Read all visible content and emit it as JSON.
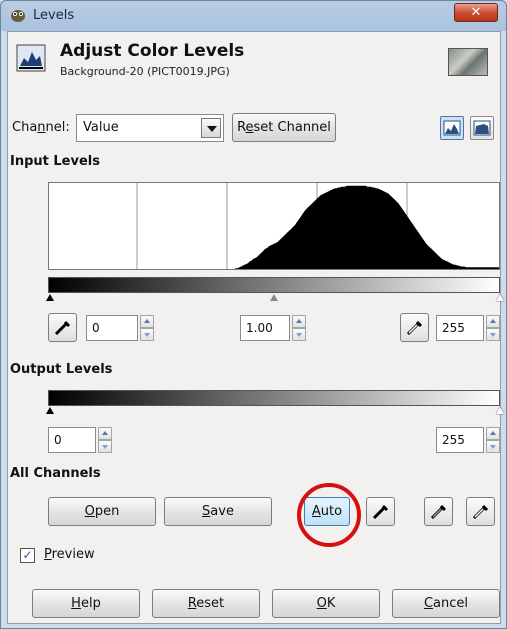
{
  "window": {
    "title": "Levels",
    "close_glyph": "✕"
  },
  "header": {
    "title": "Adjust Color Levels",
    "subtitle": "Background-20 (PICT0019.JPG)"
  },
  "channel": {
    "label_pre": "Cha",
    "label_u": "n",
    "label_post": "nel:",
    "value": "Value",
    "reset_pre": "R",
    "reset_u": "e",
    "reset_post": "set Channel"
  },
  "input_levels": {
    "heading": "Input Levels",
    "low": "0",
    "gamma": "1.00",
    "high": "255"
  },
  "output_levels": {
    "heading": "Output Levels",
    "low": "0",
    "high": "255"
  },
  "all_channels": {
    "heading": "All Channels",
    "open_u": "O",
    "open_rest": "pen",
    "save_u": "S",
    "save_rest": "ave",
    "auto_u": "A",
    "auto_rest": "uto"
  },
  "preview": {
    "u": "P",
    "rest": "review",
    "checked": true
  },
  "footer": {
    "help_u": "H",
    "help_rest": "elp",
    "reset_u": "R",
    "reset_rest": "eset",
    "ok_u": "O",
    "ok_rest": "K",
    "cancel_u": "C",
    "cancel_rest": "ancel"
  },
  "colors": {
    "highlight_circle": "#d61010",
    "accent": "#3c7fb1"
  },
  "histogram": {
    "type": "area",
    "bins": 256,
    "shape": [
      0,
      0,
      0,
      0,
      0,
      0,
      0,
      0,
      0,
      0,
      0,
      0,
      0,
      0,
      0,
      0,
      0,
      0,
      0,
      0,
      0,
      0,
      0,
      0,
      0,
      0,
      0,
      0,
      0,
      0,
      0,
      0,
      0,
      0,
      0,
      0,
      0,
      0,
      0,
      0,
      0,
      0,
      0,
      0,
      0,
      0,
      0,
      0,
      0,
      0,
      0,
      0,
      0,
      0,
      0,
      0,
      0,
      0,
      0,
      0,
      0,
      0,
      0,
      0,
      0,
      0,
      0,
      0,
      0,
      0,
      0,
      0,
      0,
      0,
      0,
      0,
      0,
      0,
      0,
      0,
      0,
      0,
      0,
      0,
      0,
      0,
      0,
      0,
      0,
      0,
      0,
      0,
      0,
      0,
      0,
      0,
      0,
      0,
      0,
      0,
      0,
      0,
      0,
      0,
      0,
      0,
      0,
      0,
      0.01,
      0.01,
      0.02,
      0.03,
      0.04,
      0.05,
      0.06,
      0.07,
      0.09,
      0.1,
      0.12,
      0.13,
      0.14,
      0.16,
      0.18,
      0.2,
      0.22,
      0.24,
      0.25,
      0.27,
      0.28,
      0.29,
      0.3,
      0.31,
      0.32,
      0.34,
      0.36,
      0.38,
      0.4,
      0.42,
      0.44,
      0.46,
      0.48,
      0.5,
      0.52,
      0.55,
      0.58,
      0.61,
      0.64,
      0.67,
      0.7,
      0.72,
      0.74,
      0.76,
      0.78,
      0.8,
      0.82,
      0.84,
      0.86,
      0.88,
      0.89,
      0.9,
      0.91,
      0.92,
      0.93,
      0.94,
      0.95,
      0.96,
      0.96,
      0.97,
      0.97,
      0.98,
      0.98,
      0.98,
      0.99,
      0.99,
      0.99,
      0.99,
      0.99,
      0.99,
      0.99,
      0.99,
      0.99,
      0.99,
      0.99,
      0.99,
      0.98,
      0.98,
      0.98,
      0.97,
      0.97,
      0.96,
      0.96,
      0.95,
      0.94,
      0.93,
      0.92,
      0.91,
      0.9,
      0.88,
      0.86,
      0.84,
      0.82,
      0.8,
      0.78,
      0.75,
      0.72,
      0.69,
      0.66,
      0.63,
      0.6,
      0.57,
      0.54,
      0.51,
      0.48,
      0.45,
      0.42,
      0.39,
      0.36,
      0.33,
      0.3,
      0.28,
      0.26,
      0.24,
      0.22,
      0.2,
      0.18,
      0.16,
      0.14,
      0.12,
      0.11,
      0.1,
      0.09,
      0.08,
      0.07,
      0.06,
      0.05,
      0.05,
      0.04,
      0.04,
      0.03,
      0.03,
      0.03,
      0.02,
      0.02,
      0.02,
      0.02,
      0.02,
      0.02,
      0.02,
      0.02,
      0.02,
      0.02,
      0.02,
      0.02,
      0.02,
      0.02,
      0.02,
      0.02,
      0.02,
      0.02,
      0.02,
      0.02
    ]
  }
}
